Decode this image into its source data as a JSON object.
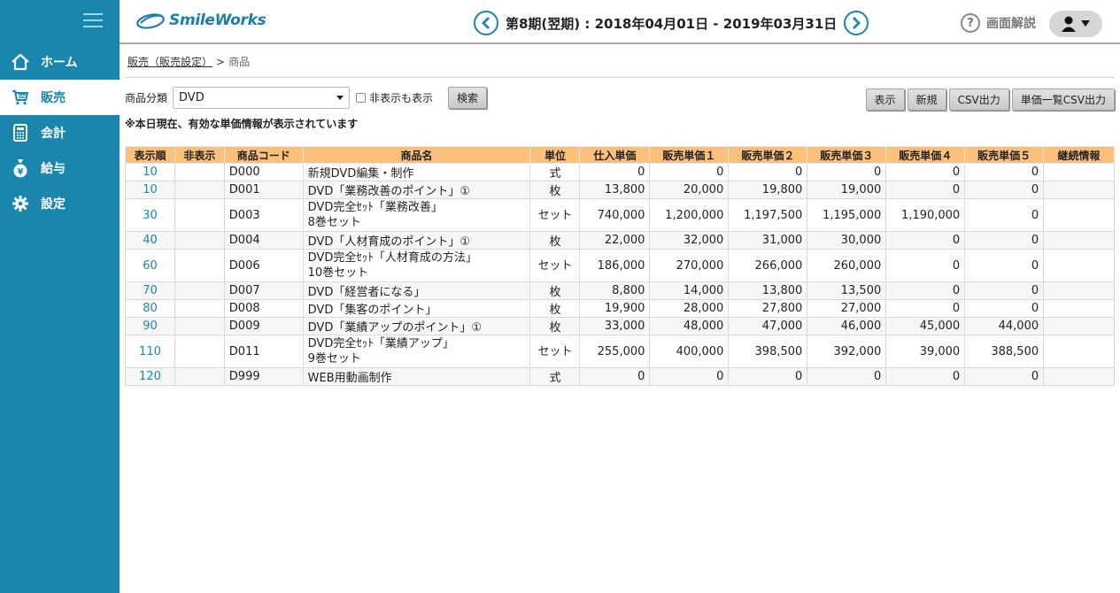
{
  "sidebar": {
    "items": [
      {
        "label": "ホーム",
        "icon": "home-icon",
        "active": false
      },
      {
        "label": "販売",
        "icon": "cart-icon",
        "active": true
      },
      {
        "label": "会計",
        "icon": "calculator-icon",
        "active": false
      },
      {
        "label": "給与",
        "icon": "yen-bag-icon",
        "active": false
      },
      {
        "label": "設定",
        "icon": "gear-icon",
        "active": false
      }
    ]
  },
  "header": {
    "logo_text": "SmileWorks",
    "period": "第8期(翌期) : 2018年04月01日 - 2019年03月31日",
    "help_label": "画面解説"
  },
  "breadcrumb": {
    "parent": "販売（販売設定）",
    "separator": ">",
    "current": "商品"
  },
  "filter": {
    "category_label": "商品分類",
    "category_value": "DVD",
    "show_hidden_label": "非表示も表示",
    "search_label": "検索"
  },
  "actions": {
    "display": "表示",
    "new": "新規",
    "csv": "CSV出力",
    "price_csv": "単価一覧CSV出力"
  },
  "note": "※本日現在、有効な単価情報が表示されています",
  "table": {
    "headers": [
      "表示順",
      "非表示",
      "商品コード",
      "商品名",
      "単位",
      "仕入単価",
      "販売単価１",
      "販売単価２",
      "販売単価３",
      "販売単価４",
      "販売単価５",
      "継続情報"
    ],
    "rows": [
      {
        "order": "10",
        "hidden": "",
        "code": "D000",
        "name1": "新規DVD編集・制作",
        "name2": "",
        "unit": "式",
        "cost": "0",
        "p1": "0",
        "p2": "0",
        "p3": "0",
        "p4": "0",
        "p5": "0",
        "cont": ""
      },
      {
        "order": "10",
        "hidden": "",
        "code": "D001",
        "name1": "DVD「業務改善のポイント」①",
        "name2": "",
        "unit": "枚",
        "cost": "13,800",
        "p1": "20,000",
        "p2": "19,800",
        "p3": "19,000",
        "p4": "0",
        "p5": "0",
        "cont": ""
      },
      {
        "order": "30",
        "hidden": "",
        "code": "D003",
        "name1": "DVD完全ｾｯﾄ「業務改善」",
        "name2": "8巻セット",
        "unit": "セット",
        "cost": "740,000",
        "p1": "1,200,000",
        "p2": "1,197,500",
        "p3": "1,195,000",
        "p4": "1,190,000",
        "p5": "0",
        "cont": ""
      },
      {
        "order": "40",
        "hidden": "",
        "code": "D004",
        "name1": "DVD「人材育成のポイント」①",
        "name2": "",
        "unit": "枚",
        "cost": "22,000",
        "p1": "32,000",
        "p2": "31,000",
        "p3": "30,000",
        "p4": "0",
        "p5": "0",
        "cont": ""
      },
      {
        "order": "60",
        "hidden": "",
        "code": "D006",
        "name1": "DVD完全ｾｯﾄ「人材育成の方法」",
        "name2": "10巻セット",
        "unit": "セット",
        "cost": "186,000",
        "p1": "270,000",
        "p2": "266,000",
        "p3": "260,000",
        "p4": "0",
        "p5": "0",
        "cont": ""
      },
      {
        "order": "70",
        "hidden": "",
        "code": "D007",
        "name1": "DVD「経営者になる」",
        "name2": "",
        "unit": "枚",
        "cost": "8,800",
        "p1": "14,000",
        "p2": "13,800",
        "p3": "13,500",
        "p4": "0",
        "p5": "0",
        "cont": ""
      },
      {
        "order": "80",
        "hidden": "",
        "code": "D008",
        "name1": "DVD「集客のポイント」",
        "name2": "",
        "unit": "枚",
        "cost": "19,900",
        "p1": "28,000",
        "p2": "27,800",
        "p3": "27,000",
        "p4": "0",
        "p5": "0",
        "cont": ""
      },
      {
        "order": "90",
        "hidden": "",
        "code": "D009",
        "name1": "DVD「業績アップのポイント」①",
        "name2": "",
        "unit": "枚",
        "cost": "33,000",
        "p1": "48,000",
        "p2": "47,000",
        "p3": "46,000",
        "p4": "45,000",
        "p5": "44,000",
        "cont": ""
      },
      {
        "order": "110",
        "hidden": "",
        "code": "D011",
        "name1": "DVD完全ｾｯﾄ「業績アップ」",
        "name2": "9巻セット",
        "unit": "セット",
        "cost": "255,000",
        "p1": "400,000",
        "p2": "398,500",
        "p3": "392,000",
        "p4": "39,000",
        "p5": "388,500",
        "cont": ""
      },
      {
        "order": "120",
        "hidden": "",
        "code": "D999",
        "name1": "WEB用動画制作",
        "name2": "",
        "unit": "式",
        "cost": "0",
        "p1": "0",
        "p2": "0",
        "p3": "0",
        "p4": "0",
        "p5": "0",
        "cont": ""
      }
    ]
  },
  "colors": {
    "sidebar": "#1a86ad",
    "table_header": "#fcc07a",
    "accent": "#1a86ad"
  }
}
